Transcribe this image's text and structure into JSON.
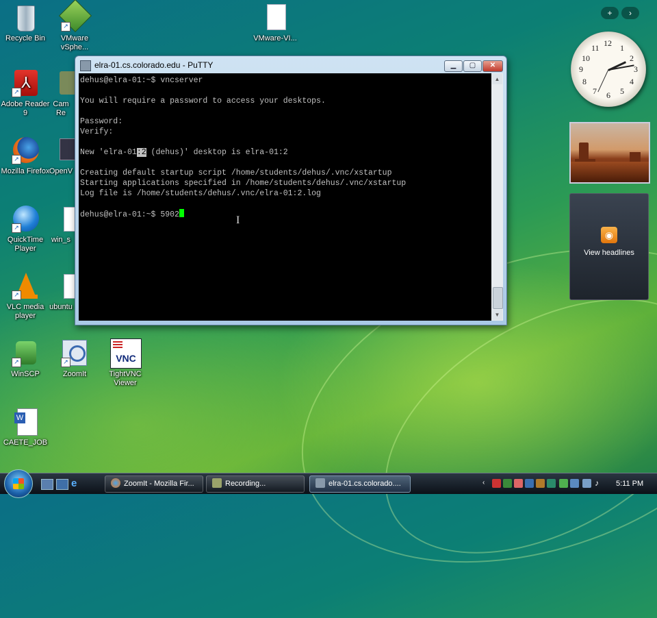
{
  "desktop": {
    "icons": [
      {
        "label": "Recycle Bin",
        "icon": "recycle-bin-icon"
      },
      {
        "label": "VMware vSphe...",
        "icon": "vmware-icon"
      },
      {
        "label": "VMware-VI...",
        "icon": "document-icon"
      },
      {
        "label": "Adobe Reader 9",
        "icon": "adobe-reader-icon"
      },
      {
        "label": "Cam Re",
        "icon": "camtasia-icon"
      },
      {
        "label": "Mozilla Firefox",
        "icon": "firefox-icon"
      },
      {
        "label": "OpenV",
        "icon": "openvpn-icon"
      },
      {
        "label": "QuickTime Player",
        "icon": "quicktime-icon"
      },
      {
        "label": "win_s",
        "icon": "document-icon"
      },
      {
        "label": "VLC media player",
        "icon": "vlc-icon"
      },
      {
        "label": "ubuntu",
        "icon": "document-icon"
      },
      {
        "label": "WinSCP",
        "icon": "winscp-icon"
      },
      {
        "label": "ZoomIt",
        "icon": "zoomit-icon"
      },
      {
        "label": "TightVNC Viewer",
        "icon": "tightvnc-icon"
      },
      {
        "label": "CAETE_JOB",
        "icon": "word-document-icon"
      }
    ]
  },
  "putty": {
    "title": "elra-01.cs.colorado.edu - PuTTY",
    "minimize": "▁",
    "maximize": "▢",
    "close": "✕",
    "lines": [
      "dehus@elra-01:~$ vncserver",
      "",
      "You will require a password to access your desktops.",
      "",
      "Password:",
      "Verify:",
      "",
      "New 'elra-01:2 (dehus)' desktop is elra-01:2",
      "",
      "Creating default startup script /home/students/dehus/.vnc/xstartup",
      "Starting applications specified in /home/students/dehus/.vnc/xstartup",
      "Log file is /home/students/dehus/.vnc/elra-01:2.log",
      "",
      "dehus@elra-01:~$ 5902"
    ],
    "highlight": {
      "before": "New 'elra-01",
      "selected": ":2",
      "after": " (dehus)' desktop is elra-01:2"
    },
    "cursor_color": "#00ff00"
  },
  "sidebar": {
    "add_label": "+",
    "more_label": "›",
    "clock_numbers": [
      "12",
      "1",
      "2",
      "3",
      "4",
      "5",
      "6",
      "7",
      "8",
      "9",
      "10",
      "11"
    ],
    "feed_label": "View headlines"
  },
  "taskbar": {
    "quicklaunch": [
      "show-desktop-icon",
      "switch-windows-icon",
      "ie-icon"
    ],
    "tasks": [
      {
        "label": "ZoomIt - Mozilla Fir...",
        "icon": "firefox-icon",
        "active": false
      },
      {
        "label": "Recording...",
        "icon": "camtasia-icon",
        "active": false
      },
      {
        "label": "elra-01.cs.colorado....",
        "icon": "putty-icon",
        "active": true
      }
    ],
    "time": "5:11 PM"
  }
}
